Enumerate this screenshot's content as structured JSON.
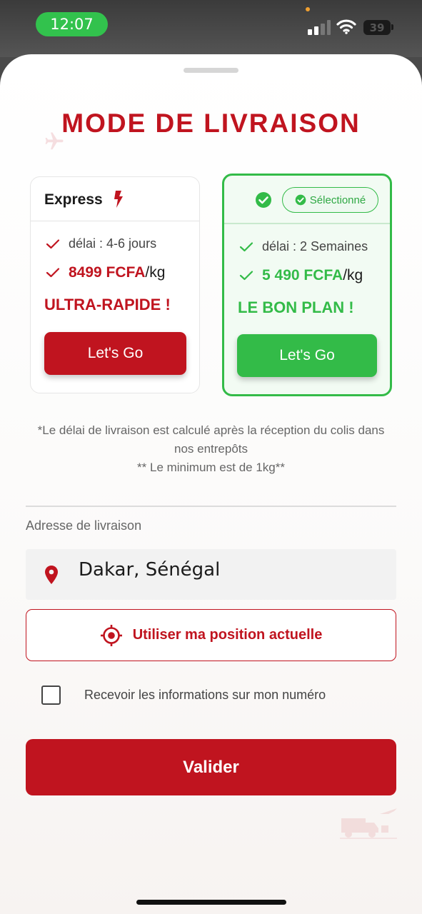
{
  "status_bar": {
    "time": "12:07",
    "battery": "39"
  },
  "header": {
    "title": "MODE DE LIVRAISON"
  },
  "options": {
    "express": {
      "name": "Express",
      "delay": "délai : 4-6 jours",
      "price": "8499 FCFA",
      "unit": "/kg",
      "slogan": "ULTRA-RAPIDE !",
      "button": "Let's Go",
      "selected": false
    },
    "standard": {
      "badge": "Sélectionné",
      "delay": "délai : 2 Semaines",
      "price": "5 490 FCFA",
      "unit": "/kg",
      "slogan": "LE BON PLAN !",
      "button": "Let's Go",
      "selected": true
    }
  },
  "notes": {
    "line1": "*Le délai de livraison est calculé après la réception du colis dans nos entrepôts",
    "line2": "** Le minimum est de 1kg**"
  },
  "address": {
    "label": "Adresse de livraison",
    "value": "Dakar, Sénégal",
    "locate_button": "Utiliser ma position actuelle"
  },
  "consent": {
    "label": "Recevoir les informations sur mon numéro",
    "checked": false
  },
  "actions": {
    "validate": "Valider"
  },
  "colors": {
    "brand_red": "#c0141f",
    "success_green": "#33bb48",
    "time_pill": "#32c24d"
  },
  "icons": {
    "express": "bolt-icon",
    "selected": "check-circle-icon",
    "feature": "check-icon",
    "location": "map-pin-icon",
    "locate": "crosshair-icon"
  }
}
